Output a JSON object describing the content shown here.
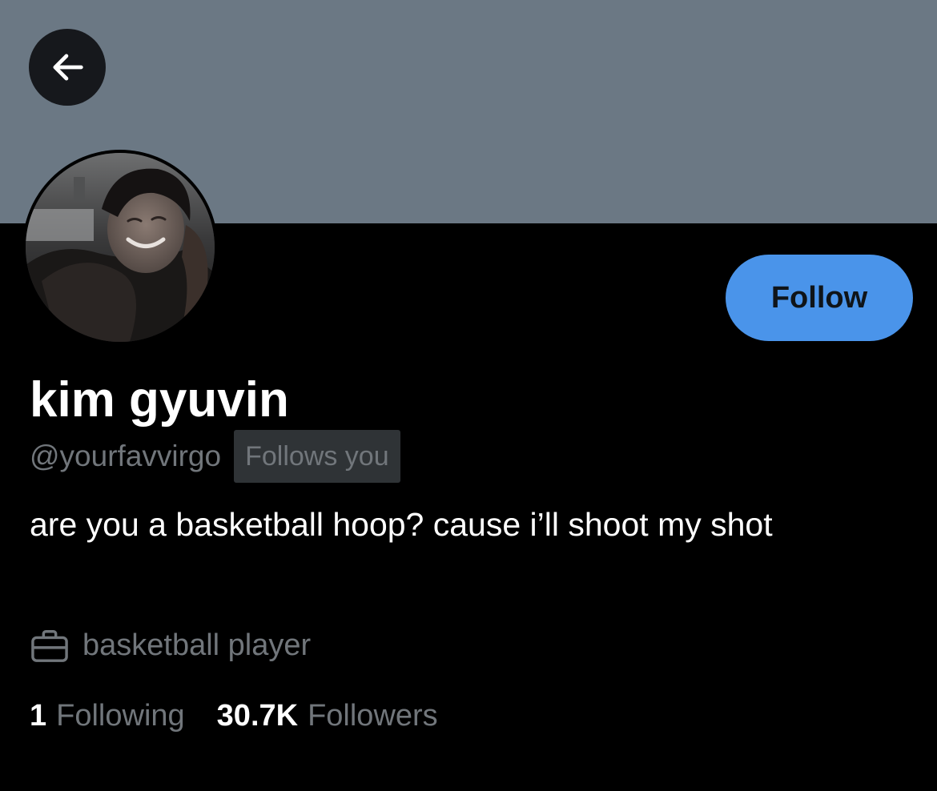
{
  "header": {
    "back_icon": "arrow-left-icon",
    "banner_color": "#6b7884"
  },
  "profile": {
    "display_name": "kim gyuvin",
    "handle": "@yourfavvirgo",
    "follows_you_label": "Follows you",
    "bio": "are you a basketball hoop? cause i’ll shoot my shot",
    "profession_icon": "briefcase-icon",
    "profession": "basketball player",
    "avatar_icon": "avatar-photo"
  },
  "actions": {
    "follow_label": "Follow",
    "follow_color": "#4a94ea"
  },
  "stats": {
    "following_count": "1",
    "following_label": "Following",
    "followers_count": "30.7K",
    "followers_label": "Followers"
  },
  "colors": {
    "background": "#000000",
    "text_primary": "#ffffff",
    "text_secondary": "#71767b",
    "badge_background": "#2f3336"
  }
}
